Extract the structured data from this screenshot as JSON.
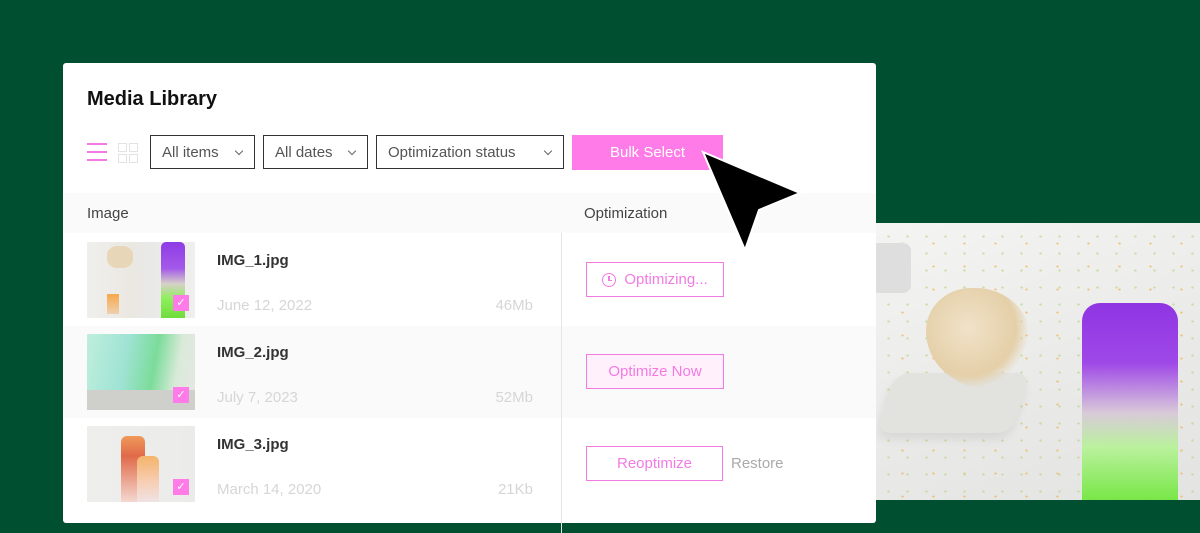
{
  "page": {
    "background_color": "#014f31",
    "accent_color": "#ff7ce8"
  },
  "library": {
    "title": "Media Library",
    "toolbar": {
      "view_list_icon": "list-view-icon",
      "view_grid_icon": "grid-view-icon",
      "filters": [
        {
          "label": "All items"
        },
        {
          "label": "All dates"
        },
        {
          "label": "Optimization status"
        }
      ],
      "bulk_select_label": "Bulk Select"
    },
    "columns": {
      "image": "Image",
      "optimization": "Optimization"
    },
    "rows": [
      {
        "name": "IMG_1.jpg",
        "date": "June 12, 2022",
        "size": "46Mb",
        "selected": true,
        "action": "Optimizing...",
        "action_icon": "clock-icon"
      },
      {
        "name": "IMG_2.jpg",
        "date": "July 7, 2023",
        "size": "52Mb",
        "selected": true,
        "action": "Optimize Now"
      },
      {
        "name": "IMG_3.jpg",
        "date": "March 14, 2020",
        "size": "21Kb",
        "selected": true,
        "action": "Reoptimize",
        "secondary_action": "Restore"
      }
    ],
    "checkmark": "✓"
  }
}
